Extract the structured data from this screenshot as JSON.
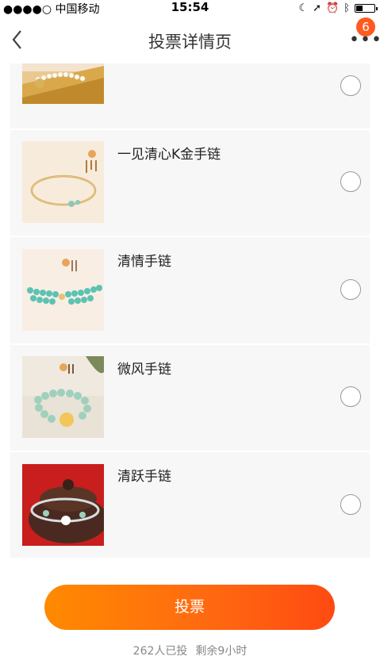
{
  "status_bar": {
    "carrier": "●●●●○ 中国移动",
    "time": "15:54"
  },
  "nav": {
    "title": "投票详情页",
    "badge_count": "6"
  },
  "items": [
    {
      "label": "",
      "thumb_style": "pearl"
    },
    {
      "label": "一见清心K金手链",
      "thumb_style": "gold"
    },
    {
      "label": "清情手链",
      "thumb_style": "turquoise"
    },
    {
      "label": "微风手链",
      "thumb_style": "jade"
    },
    {
      "label": "清跃手链",
      "thumb_style": "silver"
    }
  ],
  "vote_button": {
    "label": "投票"
  },
  "stats": {
    "voted": "262人已投",
    "remaining": "剩余9小时"
  },
  "colors": {
    "accent": "#ff6a10",
    "badge": "#ff5a1f",
    "list_bg": "#f7f7f7"
  }
}
